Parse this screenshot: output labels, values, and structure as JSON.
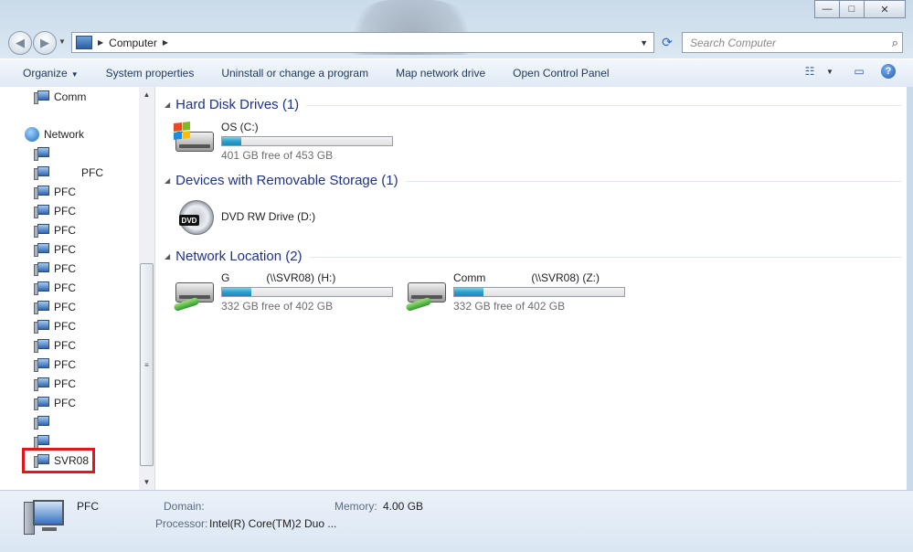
{
  "window": {
    "address_crumb": "Computer",
    "search_placeholder": "Search Computer",
    "buttons": {
      "minimize": "—",
      "maximize": "□",
      "close": "✕"
    }
  },
  "toolbar": {
    "organize": "Organize",
    "system_properties": "System properties",
    "uninstall": "Uninstall or change a program",
    "map_drive": "Map network drive",
    "control_panel": "Open Control Panel"
  },
  "nav": {
    "computer_item": "Comm",
    "network_label": "Network",
    "items": [
      "",
      "PFC",
      "PFC",
      "PFC",
      "PFC",
      "PFC",
      "PFC",
      "PFC",
      "PFC",
      "PFC",
      "PFC",
      "PFC",
      "PFC",
      "PFC",
      "",
      "",
      "SVR08"
    ],
    "highlight_color": "#e4151c"
  },
  "groups": {
    "hdd": {
      "title": "Hard Disk Drives (1)",
      "drives": [
        {
          "name": "OS (C:)",
          "free": "401 GB free of 453 GB",
          "used_fraction": 0.115
        }
      ]
    },
    "removable": {
      "title": "Devices with Removable Storage (1)",
      "drives": [
        {
          "name": "DVD RW Drive (D:)",
          "icon_label": "DVD"
        }
      ]
    },
    "network": {
      "title": "Network Location (2)",
      "drives": [
        {
          "name": "G            (\\\\SVR08) (H:)",
          "free": "332 GB free of 402 GB",
          "used_fraction": 0.174
        },
        {
          "name": "Comm               (\\\\SVR08) (Z:)",
          "free": "332 GB free of 402 GB",
          "used_fraction": 0.174
        }
      ]
    }
  },
  "details": {
    "computer_name": "PFC",
    "domain_label": "Domain:",
    "memory_label": "Memory:",
    "memory_value": "4.00 GB",
    "processor_label": "Processor:",
    "processor_value": "Intel(R) Core(TM)2 Duo ..."
  }
}
